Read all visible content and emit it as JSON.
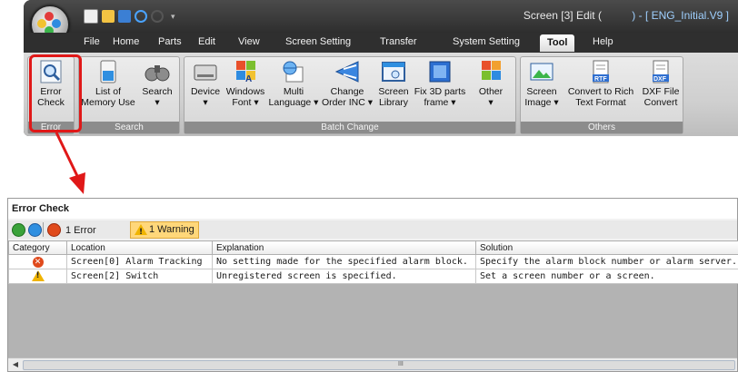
{
  "window": {
    "title_prefix": "Screen [3] Edit (",
    "title_gap": "          ",
    "title_suffix": ") - [ ENG_Initial.V9 ]"
  },
  "tabs": [
    {
      "label": "File"
    },
    {
      "label": "Home"
    },
    {
      "label": "Parts"
    },
    {
      "label": "Edit"
    },
    {
      "label": "View"
    },
    {
      "label": "Screen Setting"
    },
    {
      "label": "Transfer"
    },
    {
      "label": "System Setting"
    },
    {
      "label": "Tool",
      "active": true
    },
    {
      "label": "Help"
    }
  ],
  "ribbon": {
    "groups": {
      "error": "Error",
      "search": "Search",
      "batch_change": "Batch Change",
      "others": "Others"
    },
    "buttons": {
      "error_check": [
        "Error",
        "Check"
      ],
      "list_memory": [
        "List of",
        "Memory Use"
      ],
      "search": [
        "Search",
        "▾"
      ],
      "device": [
        "Device",
        "▾"
      ],
      "windows_font": [
        "Windows",
        "Font ▾"
      ],
      "multi_language": [
        "Multi",
        "Language ▾"
      ],
      "change_order": [
        "Change",
        "Order INC ▾"
      ],
      "screen_library": [
        "Screen",
        "Library"
      ],
      "fix_3d_parts": [
        "Fix 3D parts",
        "frame ▾"
      ],
      "other": [
        "Other",
        "▾"
      ],
      "screen_image": [
        "Screen",
        "Image ▾"
      ],
      "convert_rtf": [
        "Convert to Rich",
        "Text Format"
      ],
      "dxf_convert": [
        "DXF File",
        "Convert"
      ]
    },
    "icon_text": {
      "rtf": "RTF",
      "dxf": "DXF"
    }
  },
  "error_check": {
    "title": "Error Check",
    "error_count": "1 Error",
    "warning_count": "1 Warning",
    "columns": [
      "Category",
      "Location",
      "Explanation",
      "Solution"
    ],
    "rows": [
      {
        "category": "error",
        "location": "Screen[0] Alarm Tracking",
        "explanation": "No setting made for the specified alarm block.",
        "solution": "Specify the alarm block number or alarm server."
      },
      {
        "category": "warning",
        "location": "Screen[2] Switch",
        "explanation": "Unregistered screen is specified.",
        "solution": "Set a screen number or a screen."
      }
    ],
    "scroll_grip": "III"
  },
  "colors": {
    "highlight": "#e01818",
    "error": "#e04a1c",
    "warning": "#f0b400",
    "ribbon_dark": "#2f2f2f"
  }
}
